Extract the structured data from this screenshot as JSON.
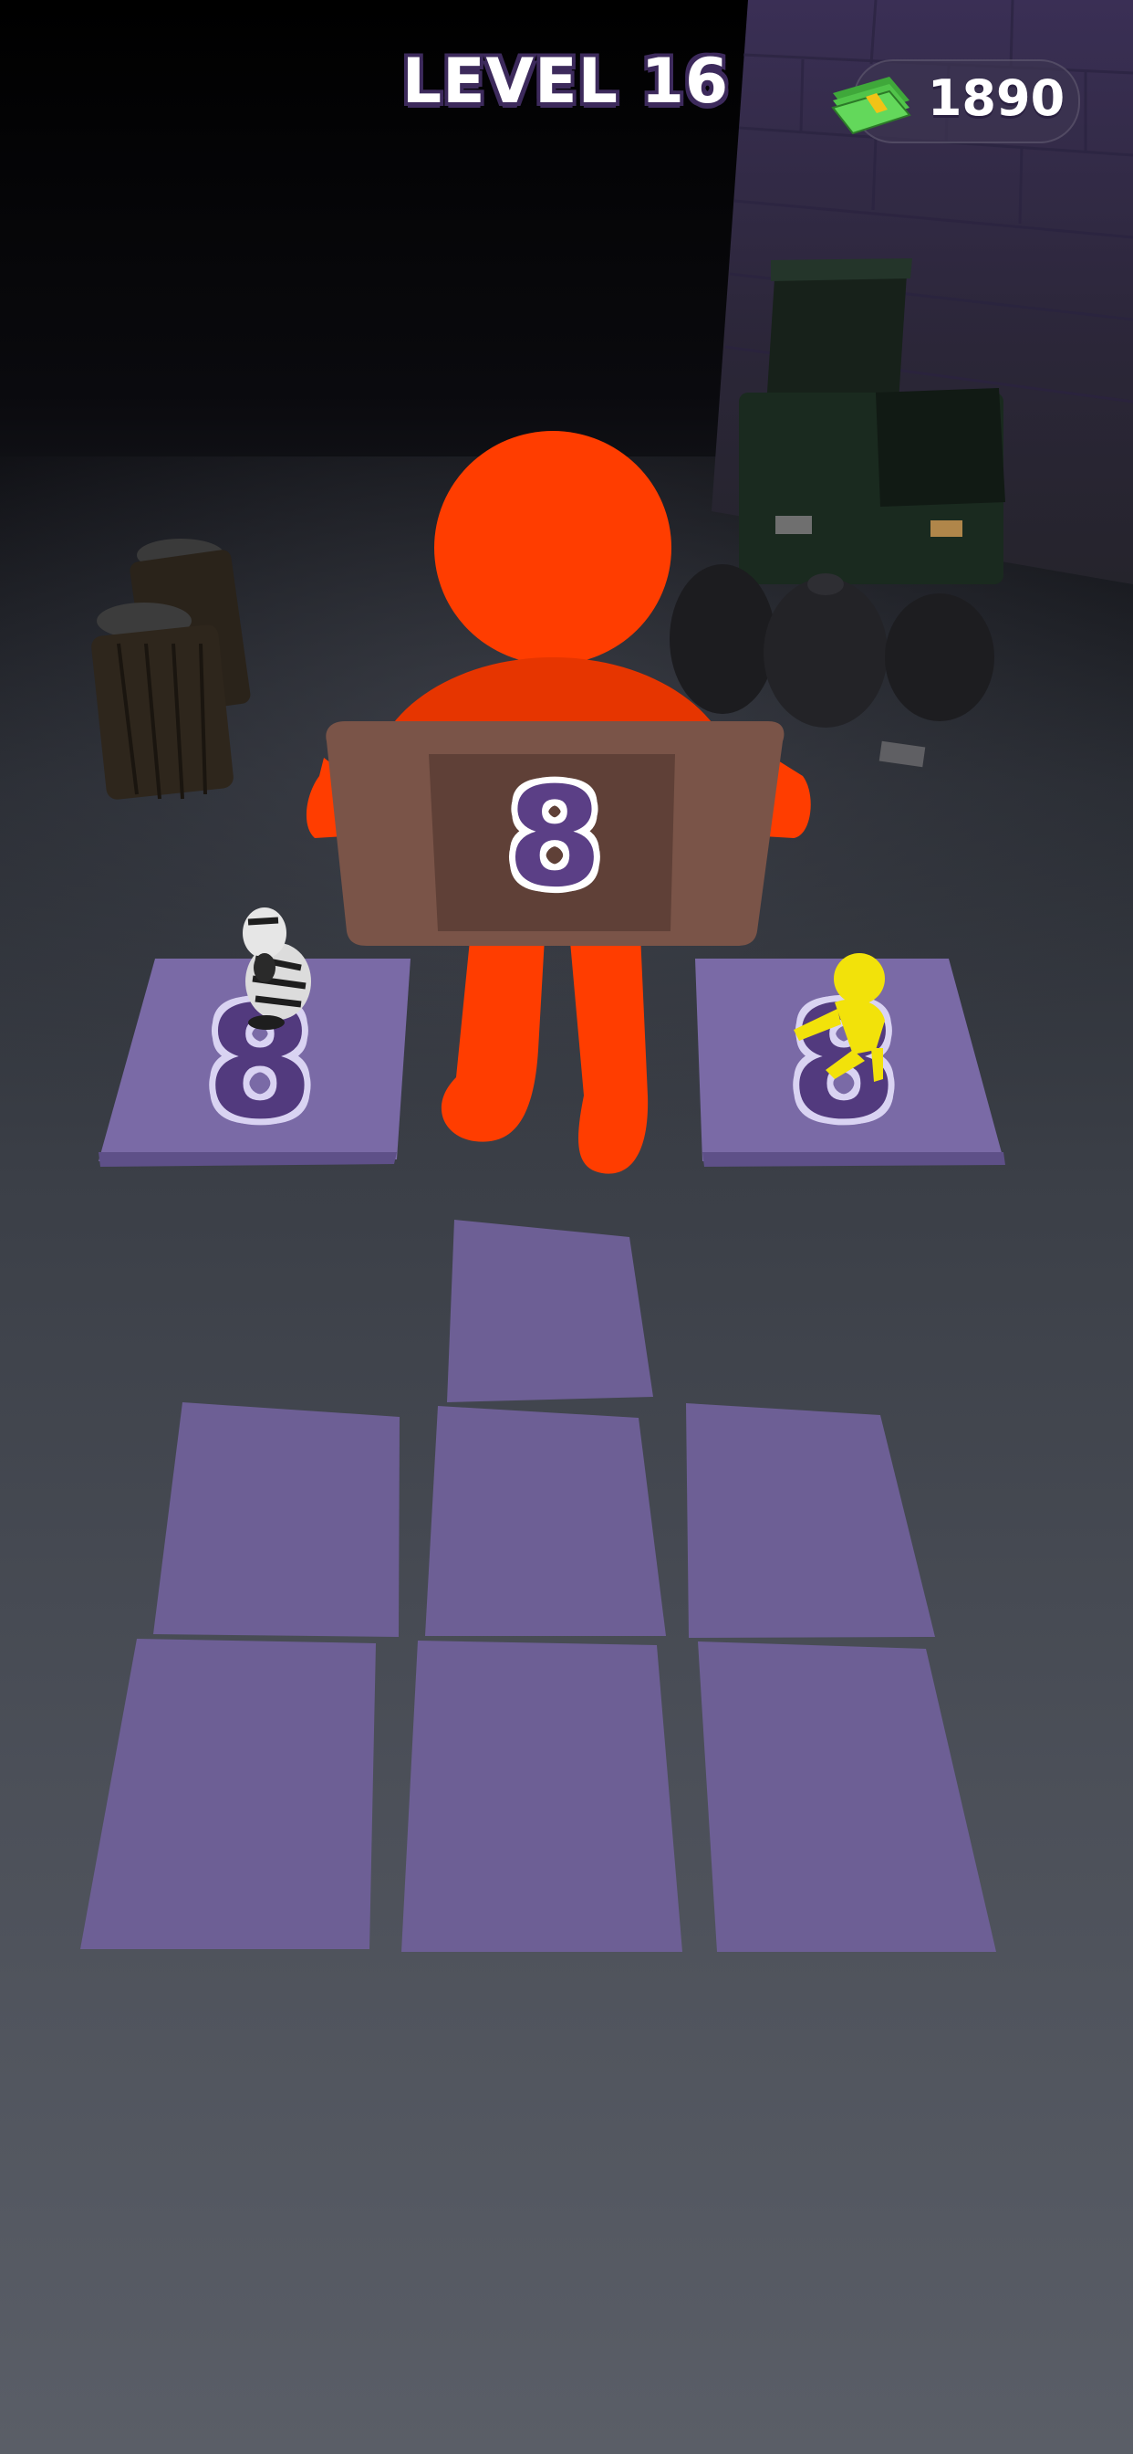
{
  "hud": {
    "level_label": "LEVEL 16",
    "cash_amount": "1890",
    "cash_icon": "cash-stack-icon"
  },
  "sign": {
    "number": "8"
  },
  "tiles": {
    "left_number": "8",
    "right_number": "8"
  },
  "colors": {
    "character": "#ff3d00",
    "tile": "#7a6aa6",
    "sign_board": "#7a5448",
    "number_purple": "#5b3f86",
    "companion_yellow": "#f2e20a"
  }
}
